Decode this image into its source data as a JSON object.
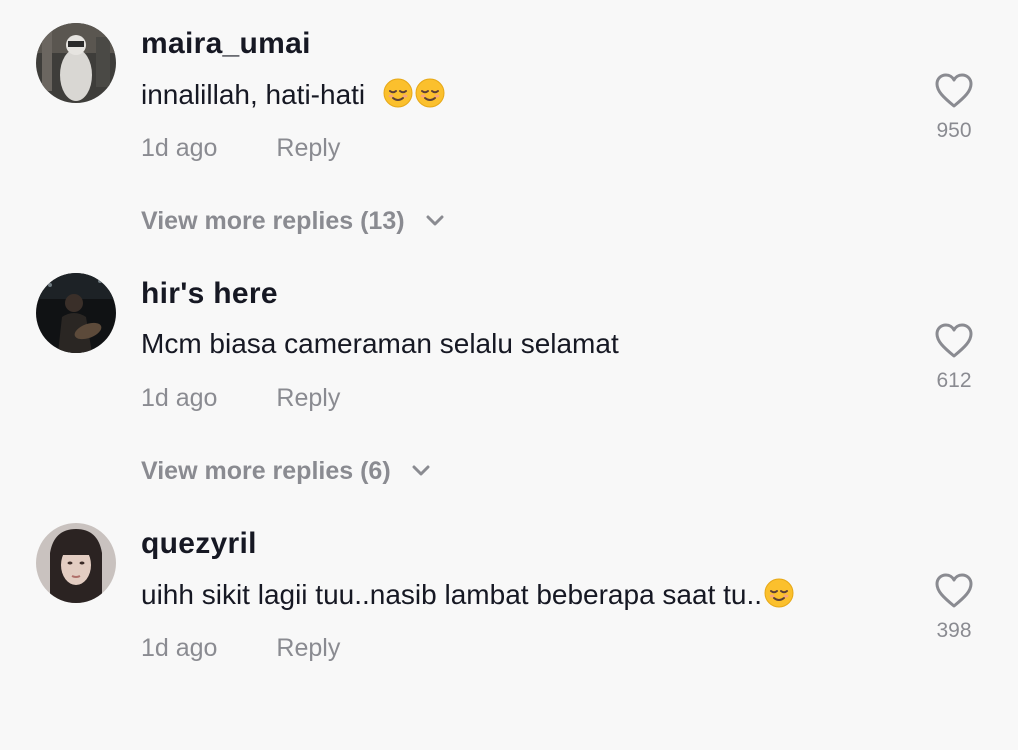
{
  "comments": [
    {
      "username": "maira_umai",
      "text": "innalillah, hati-hati",
      "emojis": [
        "relieved-face",
        "relieved-face"
      ],
      "time": "1d ago",
      "reply_label": "Reply",
      "likes": "950",
      "view_more": "View more replies (13)"
    },
    {
      "username": "hir's here",
      "text": "Mcm biasa cameraman selalu selamat",
      "emojis": [],
      "time": "1d ago",
      "reply_label": "Reply",
      "likes": "612",
      "view_more": "View more replies (6)"
    },
    {
      "username": "quezyril",
      "text": "uihh sikit lagii tuu..nasib lambat beberapa saat tu..",
      "emojis": [
        "relieved-face"
      ],
      "time": "1d ago",
      "reply_label": "Reply",
      "likes": "398"
    }
  ],
  "colors": {
    "background": "#f8f8f8",
    "username": "#161823",
    "secondary": "#8a8b91",
    "emoji": "#fbc02d"
  },
  "icons": [
    "heart-outline-icon",
    "chevron-down-icon"
  ]
}
